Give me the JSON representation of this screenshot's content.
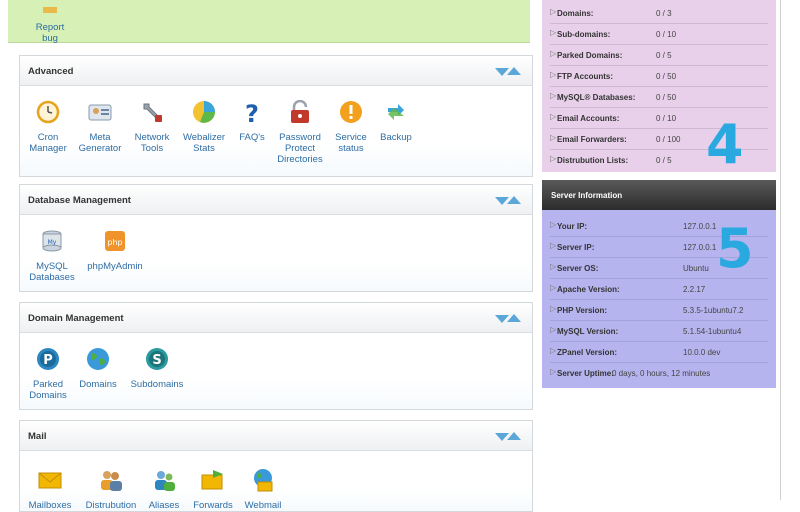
{
  "top": {
    "report_bug": "Report\nbug"
  },
  "panels": {
    "advanced": {
      "title": "Advanced",
      "items": [
        "Cron Manager",
        "Meta Generator",
        "Network Tools",
        "Webalizer Stats",
        "FAQ's",
        "Password Protect Directories",
        "Service status",
        "Backup"
      ]
    },
    "database": {
      "title": "Database Management",
      "items": [
        "MySQL Databases",
        "phpMyAdmin"
      ]
    },
    "domain": {
      "title": "Domain Management",
      "items": [
        "Parked Domains",
        "Domains",
        "Subdomains"
      ]
    },
    "mail": {
      "title": "Mail",
      "items": [
        "Mailboxes",
        "Distrubution",
        "Aliases",
        "Forwards",
        "Webmail"
      ]
    }
  },
  "stats": [
    {
      "k": "Domains:",
      "v": "0 / 3"
    },
    {
      "k": "Sub-domains:",
      "v": "0 / 10"
    },
    {
      "k": "Parked Domains:",
      "v": "0 / 5"
    },
    {
      "k": "FTP Accounts:",
      "v": "0 / 50"
    },
    {
      "k": "MySQL® Databases:",
      "v": "0 / 50"
    },
    {
      "k": "Email Accounts:",
      "v": "0 / 10"
    },
    {
      "k": "Email Forwarders:",
      "v": "0 / 100"
    },
    {
      "k": "Distrubution Lists:",
      "v": "0 / 5"
    }
  ],
  "server": {
    "title": "Server Information",
    "rows": [
      {
        "k": "Your IP:",
        "v": "127.0.0.1"
      },
      {
        "k": "Server IP:",
        "v": "127.0.0.1"
      },
      {
        "k": "Server OS:",
        "v": "Ubuntu"
      },
      {
        "k": "Apache Version:",
        "v": "2.2.17"
      },
      {
        "k": "PHP Version:",
        "v": "5.3.5-1ubuntu7.2"
      },
      {
        "k": "MySQL Version:",
        "v": "5.1.54-1ubuntu4"
      },
      {
        "k": "ZPanel Version:",
        "v": "10.0.0 dev"
      },
      {
        "k": "Server Uptime:",
        "v": "0 days, 0 hours, 12 minutes"
      }
    ]
  },
  "annotations": {
    "four": "4",
    "five": "5"
  },
  "colors": {
    "top_band": "#d6f0b6",
    "stats_bg": "#e8d0ea",
    "server_bg": "#b5b4ee",
    "link": "#2e6da4",
    "annotation": "#29a9df"
  }
}
